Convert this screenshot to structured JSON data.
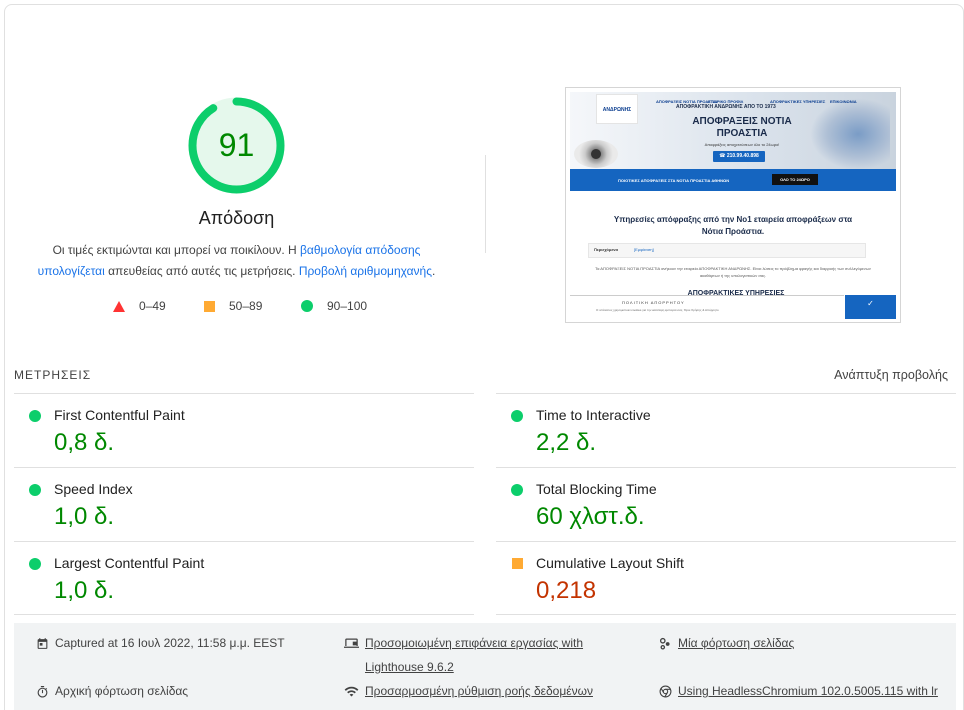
{
  "performance": {
    "score": "91",
    "score_value": 91,
    "title": "Απόδοση",
    "desc_pre": "Οι τιμές εκτιμώνται και μπορεί να ποικίλουν. Η ",
    "desc_link1": "βαθμολογία απόδοσης υπολογίζεται",
    "desc_mid": " απευθείας από αυτές τις μετρήσεις. ",
    "desc_link2": "Προβολή αριθμομηχανής",
    "desc_post": ".",
    "gauge_color": "#0cce6b",
    "score_color": "#008800"
  },
  "legend": {
    "fail": "0–49",
    "average": "50–89",
    "pass": "90–100"
  },
  "thumbnail": {
    "logo": "ΑΝΔΡΩΝΗΣ",
    "nav": [
      "ΑΠΟΦΡΑΞΕΙΣ ΝΟΤΙΑ ΠΡΟΑΣΤΙΑ",
      "ΕΤΑΙΡΙΚΟ ΠΡΟΦΙΛ",
      "ΑΠΟΦΡΑΚΤΙΚΕΣ ΥΠΗΡΕΣΙΕΣ",
      "ΕΠΙΚΟΙΝΩΝΙΑ"
    ],
    "tagline": "ΑΠΟΦΡΑΚΤΙΚΗ ΑΝΔΡΩΝΗΣ ΑΠΟ ΤΟ 1973",
    "headline": "ΑΠΟΦΡΑΞΕΙΣ ΝΟΤΙΑ ΠΡΟΑΣΤΙΑ",
    "sub": "Αποφράξεις αποχετεύσεων όλο το 24ωρο!",
    "phone": "☎ 210.99.40.898",
    "bar_text": "ΠΟΙΟΤΙΚΕΣ ΑΠΟΦΡΑΞΕΙΣ ΣΤΑ ΝΟΤΙΑ ΠΡΟΑΣΤΙΑ ΑΘΗΝΩΝ",
    "bar_button": "ΟΛΟ ΤΟ 24ΩΡΟ",
    "section_title": "Υπηρεσίες απόφραξης από την Νο1 εταιρεία αποφράξεων στα Νότια Προάστια.",
    "box_label": "Περιεχόμενα",
    "box_link": "[Εμφάνιση]",
    "body_text": "Τα ΑΠΟΦΡΑΞΕΙΣ ΝΟΤΙΑ ΠΡΟΑΣΤΙΑ ανήκουν την εταιρεία ΑΠΟΦΡΑΚΤΙΚΗ ΑΝΔΡΩΝΗΣ. Είναι λύσεις το πρόβλημα φραγής και διαρροής των συλλεγόμενων ακαθάρτων ή της υπολογιστικών σας.",
    "services_title": "ΑΠΟΦΡΑΚΤΙΚΕΣ ΥΠΗΡΕΣΙΕΣ",
    "cookie_title": "ΠΟΛΙΤΙΚΗ ΑΠΟΡΡΗΤΟΥ",
    "cookie_text": "Ο ιστότοπος χρησιμοποιεί cookies για την καλύτερη εμπειρία σας. Όροι Χρήσης & Απόρρητο",
    "accept": "✓"
  },
  "metrics": {
    "label": "ΜΕΤΡΗΣΕΙΣ",
    "expand": "Ανάπτυξη προβολής",
    "items": [
      {
        "name": "First Contentful Paint",
        "value": "0,8 δ.",
        "rating": "pass"
      },
      {
        "name": "Time to Interactive",
        "value": "2,2 δ.",
        "rating": "pass"
      },
      {
        "name": "Speed Index",
        "value": "1,0 δ.",
        "rating": "pass"
      },
      {
        "name": "Total Blocking Time",
        "value": "60 χλστ.δ.",
        "rating": "pass"
      },
      {
        "name": "Largest Contentful Paint",
        "value": "1,0 δ.",
        "rating": "pass"
      },
      {
        "name": "Cumulative Layout Shift",
        "value": "0,218",
        "rating": "average"
      }
    ]
  },
  "info": {
    "captured": "Captured at 16 Ιουλ 2022, 11:58 μ.μ. EEST",
    "device_line1": "Προσομοιωμένη επιφάνεια εργασίας with",
    "device_line2": "Lighthouse 9.6.2",
    "single_load": "Μία φόρτωση σελίδας",
    "initial_load": "Αρχική φόρτωση σελίδας",
    "throttling": "Προσαρμοσμένη ρύθμιση ροής δεδομένων",
    "browser": "Using HeadlessChromium 102.0.5005.115 with lr"
  },
  "colors": {
    "pass": "#0cce6b",
    "pass_text": "#008800",
    "average": "#ffaa33",
    "average_text": "#c33300",
    "fail": "#ff3333",
    "link": "#1a73e8"
  }
}
